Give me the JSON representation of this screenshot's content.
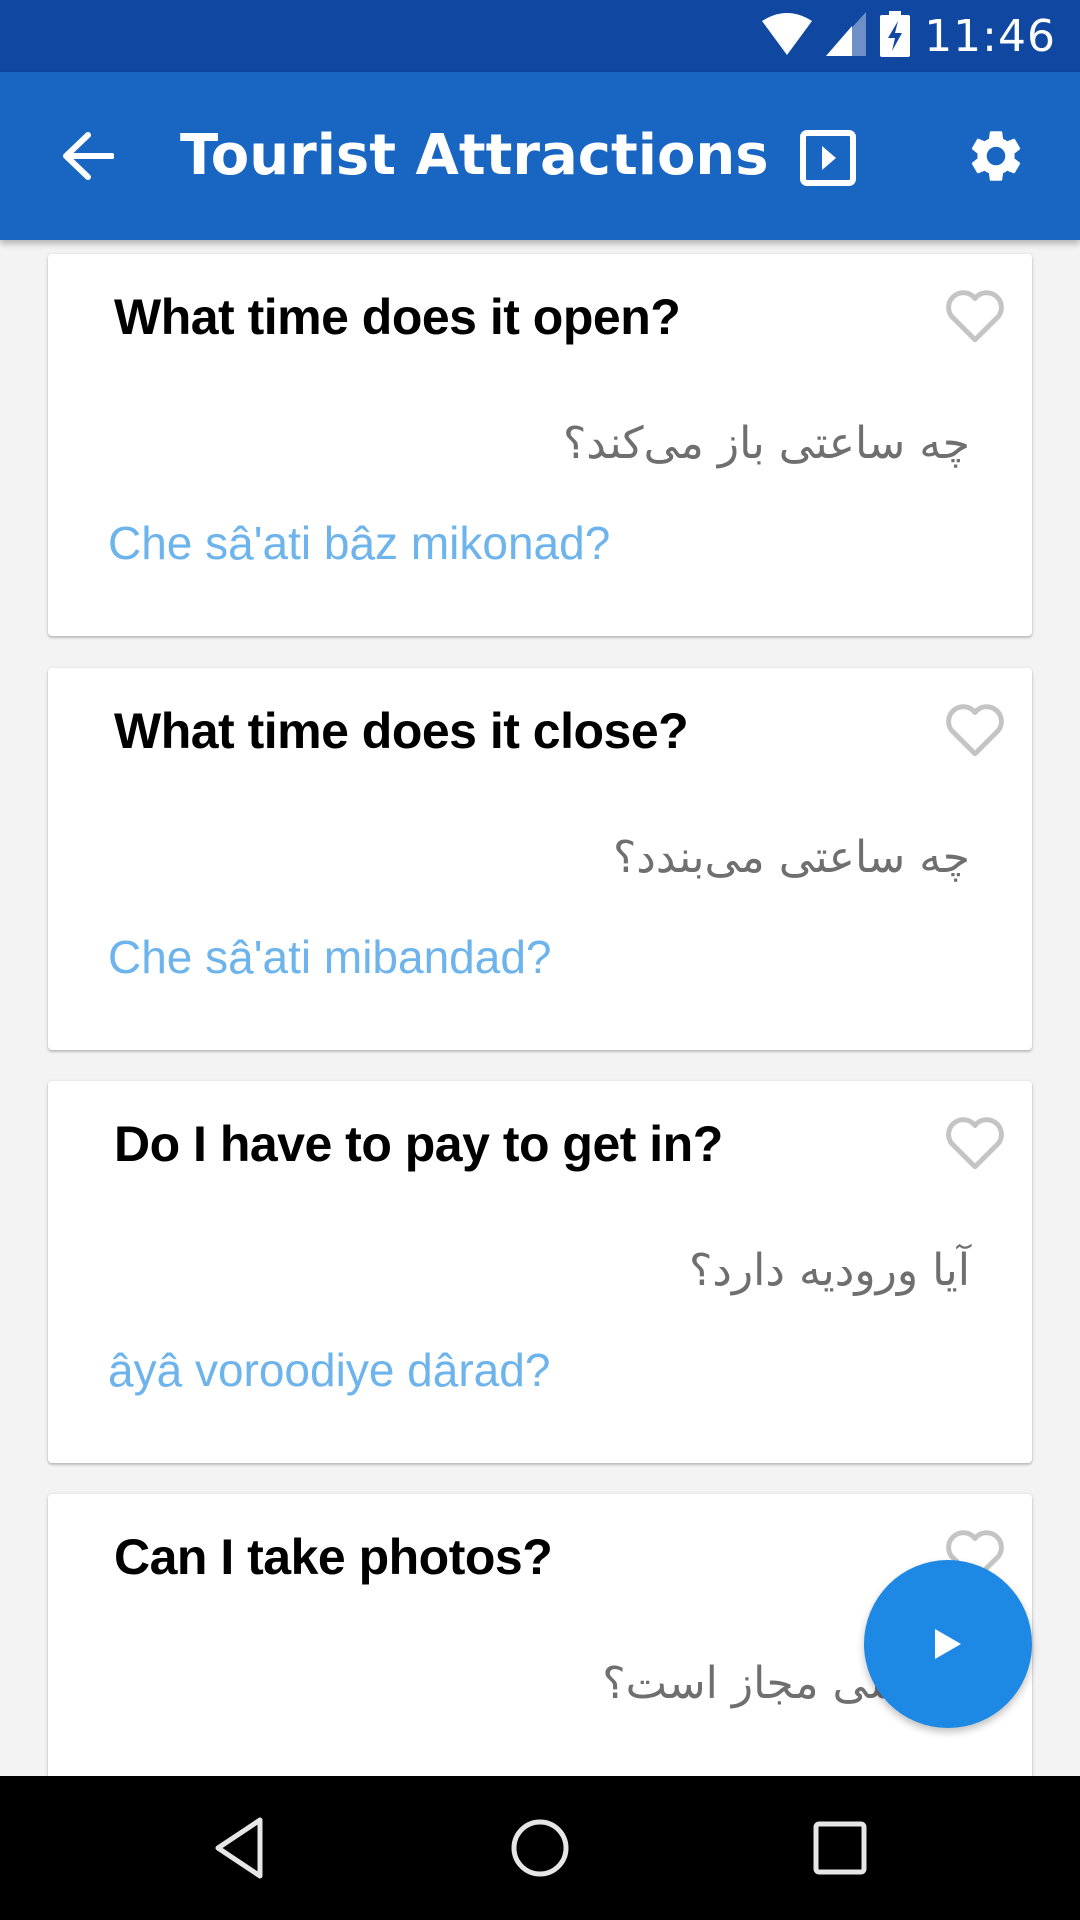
{
  "status_bar": {
    "time": "11:46",
    "icons": [
      "wifi-icon",
      "cell-signal-icon",
      "battery-charging-icon"
    ]
  },
  "app_bar": {
    "title": "Tourist Attractions",
    "back_icon": "arrow-left-icon",
    "actions": [
      "slideshow-play-icon",
      "gear-icon"
    ]
  },
  "colors": {
    "status_bar": "#0f47a1",
    "app_bar": "#1866c2",
    "fab": "#1e88e5",
    "transliteration": "#6db3ec",
    "persian_text": "#6f6f6f",
    "heart_outline": "#c4c4c4"
  },
  "phrases": [
    {
      "english": "What time does it open?",
      "persian": "چه ساعتی باز می‌کند؟",
      "transliteration": "Che sâ'ati bâz mikonad?",
      "favorite": false
    },
    {
      "english": "What time does it close?",
      "persian": "چه ساعتی می‌بندد؟",
      "transliteration": "Che sâ'ati mibandad?",
      "favorite": false
    },
    {
      "english": "Do I have to pay to get in?",
      "persian": "آیا ورودیه دارد؟",
      "transliteration": "âyâ voroodiye dârad?",
      "favorite": false
    },
    {
      "english": "Can I take photos?",
      "persian": "عکاسی مجاز است؟",
      "transliteration": "",
      "favorite": false
    }
  ],
  "fab": {
    "icon": "play-icon"
  },
  "nav_bar": {
    "buttons": [
      "back-triangle-icon",
      "home-circle-icon",
      "recents-square-icon"
    ]
  }
}
